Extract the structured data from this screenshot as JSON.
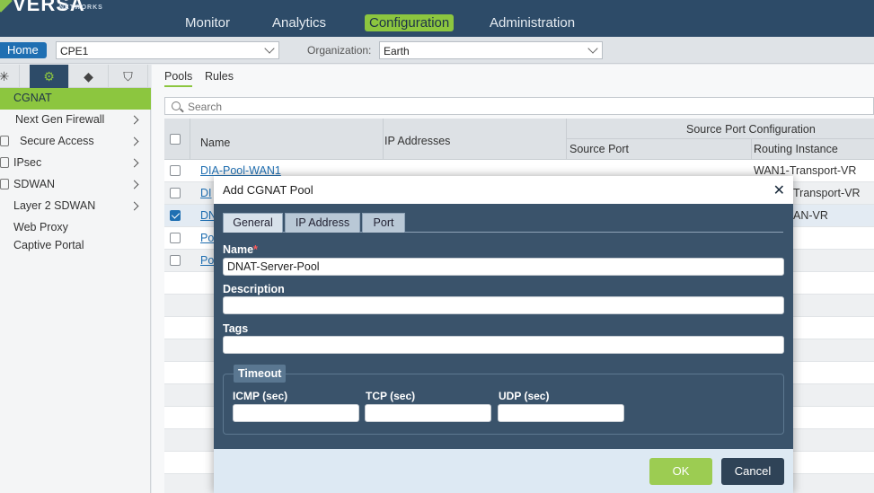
{
  "brand": {
    "name": "VERSA",
    "sub": "NETWORKS"
  },
  "nav": {
    "items": [
      "Monitor",
      "Analytics",
      "Configuration",
      "Administration"
    ],
    "active": "Configuration"
  },
  "subbar": {
    "home": "Home",
    "device": "CPE1",
    "org_label": "Organization:",
    "org": "Earth"
  },
  "sidebar": {
    "tab_icons": [
      "network-icon",
      "gear-icon",
      "box-icon",
      "shield-icon"
    ],
    "items": [
      {
        "label": "CGNAT",
        "active": true
      },
      {
        "label": "Next Gen Firewall"
      },
      {
        "label": "Secure Access"
      },
      {
        "label": "IPsec"
      },
      {
        "label": "SDWAN"
      },
      {
        "label": "Layer 2 SDWAN"
      },
      {
        "label": "Web Proxy"
      },
      {
        "label": "Captive Portal"
      }
    ]
  },
  "content": {
    "tabs": [
      "Pools",
      "Rules"
    ],
    "search_placeholder": "Search",
    "headers": {
      "name": "Name",
      "ip": "IP Addresses",
      "group": "Source Port Configuration",
      "source_port": "Source Port",
      "routing": "Routing Instance"
    },
    "rows": [
      {
        "name": "DIA-Pool-WAN1",
        "routing": "WAN1-Transport-VR"
      },
      {
        "name": "DI",
        "routing": "Transport-VR"
      },
      {
        "name": "DN",
        "routing": "AN-VR",
        "checked": true
      },
      {
        "name": "Po",
        "routing": ""
      },
      {
        "name": "Po",
        "routing": ""
      }
    ]
  },
  "modal": {
    "title": "Add CGNAT Pool",
    "close": "✕",
    "tabs": [
      "General",
      "IP Address",
      "Port"
    ],
    "name_label": "Name",
    "required_mark": "*",
    "name_value": "DNAT-Server-Pool",
    "description_label": "Description",
    "tags_label": "Tags",
    "timeout_label": "Timeout",
    "icmp_label": "ICMP (sec)",
    "tcp_label": "TCP (sec)",
    "udp_label": "UDP (sec)",
    "ok": "OK",
    "cancel": "Cancel"
  }
}
